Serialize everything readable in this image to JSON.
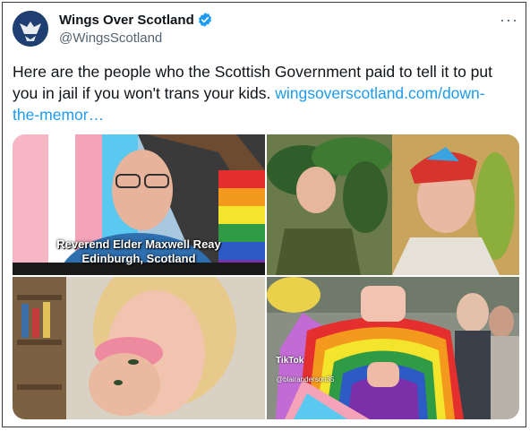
{
  "account": {
    "name": "Wings Over Scotland",
    "handle": "@WingsScotland",
    "verified": true
  },
  "tweet": {
    "text": "Here are the people who the Scottish Government paid to tell it to put you in jail if you won't trans your kids. ",
    "link": "wingsoverscotland.com/down-the-memor…"
  },
  "menu": {
    "more": "···"
  },
  "media": {
    "image1": {
      "caption_line1": "Reverend Elder Maxwell Reay",
      "caption_line2": "Edinburgh, Scotland"
    },
    "image4": {
      "tiktok_label": "TikTok",
      "tiktok_handle": "@blairanderson35"
    }
  },
  "colors": {
    "link": "#1d9bf0",
    "verified": "#1d9bf0",
    "handle": "#536471"
  }
}
